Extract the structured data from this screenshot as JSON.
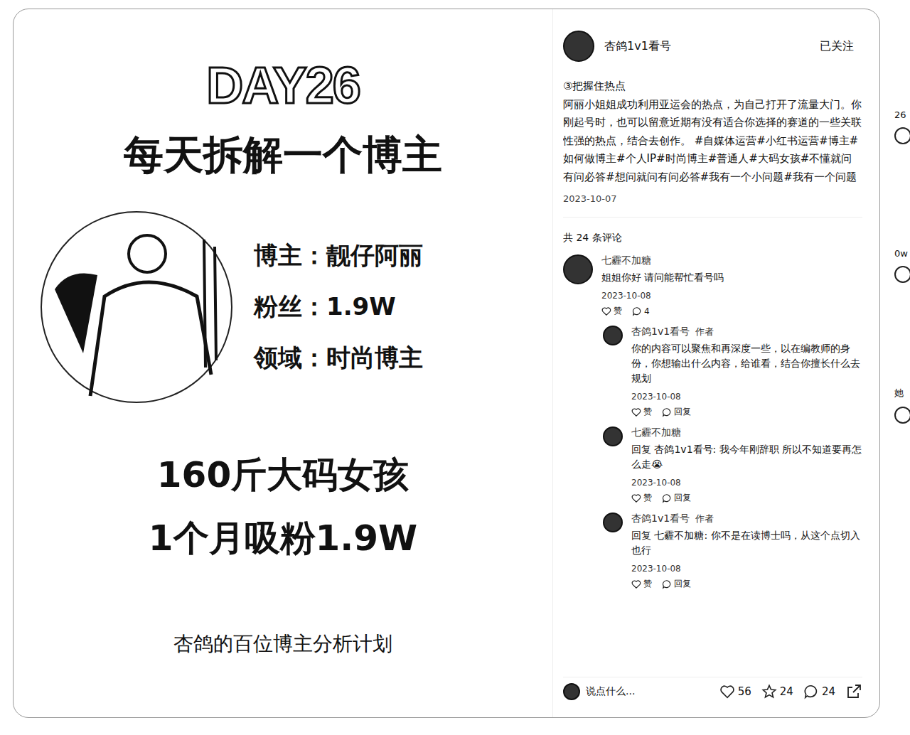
{
  "card": {
    "day": "DAY26",
    "title": "每天拆解一个博主",
    "fields": [
      {
        "label": "博主：",
        "value": "靓仔阿丽"
      },
      {
        "label": "粉丝：",
        "value": "1.9W"
      },
      {
        "label": "领域：",
        "value": "时尚博主"
      }
    ],
    "headline": [
      "160斤大码女孩",
      "1个月吸粉1.9W"
    ],
    "footer": "杏鸽的百位博主分析计划"
  },
  "author": {
    "name": "杏鸽1v1看号",
    "follow": "已关注"
  },
  "post": {
    "heading": "③把握住热点",
    "text": "阿丽小姐姐成功利用亚运会的热点，为自己打开了流量大门。你刚起号时，也可以留意近期有没有适合你选择的赛道的一些关联性强的热点，结合去创作。",
    "tags": [
      "#自媒体运营",
      "#小红书运营",
      "#博主",
      "#如何做博主",
      "#个人IP",
      "#时尚博主",
      "#普通人",
      "#大码女孩",
      "#不懂就问有问必答",
      "#想问就问有问必答",
      "#我有一个小问题",
      "#我有一个问题"
    ],
    "date": "2023-10-07"
  },
  "comments_count": "共 24 条评论",
  "comments": [
    {
      "kind": "top",
      "name": "七霾不加糖",
      "badge": "",
      "text": "姐姐你好 请问能帮忙看号吗",
      "date": "2023-10-08",
      "like": "赞",
      "action": "4"
    },
    {
      "kind": "reply",
      "name": "杏鸽1v1看号",
      "badge": "作者",
      "text": "你的内容可以聚焦和再深度一些，以在编教师的身份，你想输出什么内容，给谁看，结合你擅长什么去规划",
      "date": "2023-10-08",
      "like": "赞",
      "action": "回复"
    },
    {
      "kind": "reply",
      "name": "七霾不加糖",
      "badge": "",
      "text": "回复 杏鸽1v1看号: 我今年刚辞职 所以不知道要再怎么走😭",
      "date": "2023-10-08",
      "like": "赞",
      "action": "回复"
    },
    {
      "kind": "reply",
      "name": "杏鸽1v1看号",
      "badge": "作者",
      "text": "回复 七霾不加糖: 你不是在读博士吗，从这个点切入也行",
      "date": "2023-10-08",
      "like": "赞",
      "action": "回复"
    }
  ],
  "bottom": {
    "placeholder": "说点什么...",
    "likes": "56",
    "stars": "24",
    "comments": "24"
  },
  "side": [
    "26",
    "0w",
    "她"
  ]
}
